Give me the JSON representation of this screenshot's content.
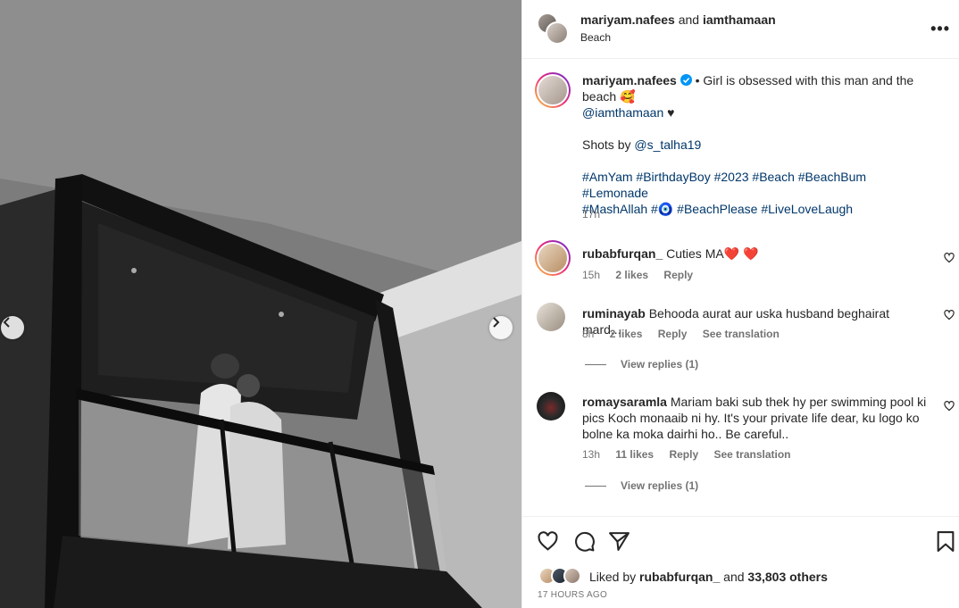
{
  "header": {
    "user1": "mariyam.nafees",
    "joiner": "and",
    "user2": "iamthamaan",
    "location": "Beach"
  },
  "caption": {
    "username": "mariyam.nafees",
    "text": "• Girl is obsessed with this man and the beach 🥰",
    "mention": "@iamthamaan",
    "mention_suffix": "♥",
    "shots_label": "Shots by",
    "shots_mention": "@s_talha19",
    "hashtags_line1": "#AmYam #BirthdayBoy #2023 #Beach #BeachBum #Lemonade",
    "hashtags_line2_a": "#MashAllah #",
    "hashtags_line2_b": "🧿",
    "hashtags_line2_c": " #BeachPlease #LiveLoveLaugh",
    "time": "17h"
  },
  "comments": [
    {
      "username": "rubabfurqan_",
      "text": "Cuties MA❤️ ❤️",
      "time": "15h",
      "likes": "2 likes",
      "reply": "Reply"
    },
    {
      "username": "ruminayab",
      "text": "Behooda aurat aur uska husband beghairat mard....",
      "time": "8h",
      "likes": "2 likes",
      "reply": "Reply",
      "translate": "See translation",
      "view_replies": "View replies (1)"
    },
    {
      "username": "romaysaramla",
      "text": "Mariam baki sub thek hy per swimming pool ki pics Koch monaaib ni hy. It's your private life dear, ku logo ko bolne ka moka dairhi ho.. Be careful..",
      "time": "13h",
      "likes": "11 likes",
      "reply": "Reply",
      "translate": "See translation",
      "view_replies": "View replies (1)"
    }
  ],
  "footer": {
    "liked_by_label": "Liked by",
    "liked_by_user": "rubabfurqan_",
    "and_label": "and",
    "others": "33,803 others",
    "posted_ago": "17 HOURS AGO"
  },
  "icons": [
    "chevron-left-icon",
    "chevron-right-icon",
    "more-icon",
    "verified-icon",
    "heart-icon",
    "comment-icon",
    "share-icon",
    "save-icon"
  ],
  "colors": {
    "link": "#00376b",
    "verified": "#0095f6",
    "muted": "#737373"
  }
}
